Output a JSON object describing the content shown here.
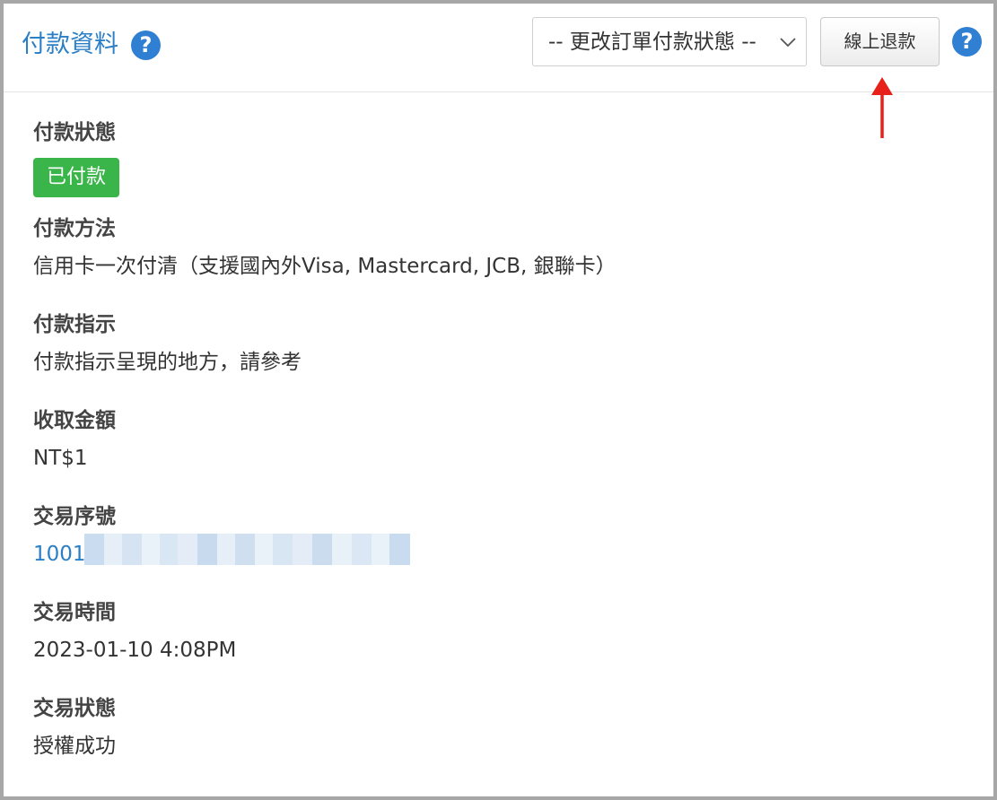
{
  "header": {
    "title": "付款資料",
    "help_glyph": "?",
    "status_select": {
      "selected": "-- 更改訂單付款狀態 --"
    },
    "refund_button_label": "線上退款"
  },
  "fields": {
    "payment_status": {
      "label": "付款狀態",
      "badge": "已付款"
    },
    "payment_method": {
      "label": "付款方法",
      "value": "信用卡一次付清（支援國內外Visa, Mastercard, JCB, 銀聯卡）"
    },
    "payment_instructions": {
      "label": "付款指示",
      "value": "付款指示呈現的地方，請參考"
    },
    "amount": {
      "label": "收取金額",
      "value": "NT$1"
    },
    "transaction_id": {
      "label": "交易序號",
      "value_visible": "1001"
    },
    "transaction_time": {
      "label": "交易時間",
      "value": "2023-01-10 4:08PM"
    },
    "transaction_status": {
      "label": "交易狀態",
      "value": "授權成功"
    }
  },
  "colors": {
    "accent": "#2b7fc6",
    "help_icon": "#2f7fd2",
    "badge_success": "#3ab54a",
    "annotation_arrow": "#e8201a"
  },
  "icons": {
    "title_help": "question-circle-icon",
    "header_help": "question-circle-icon",
    "select_chevron": "chevron-down-icon",
    "annotation": "red-arrow-up-icon"
  }
}
